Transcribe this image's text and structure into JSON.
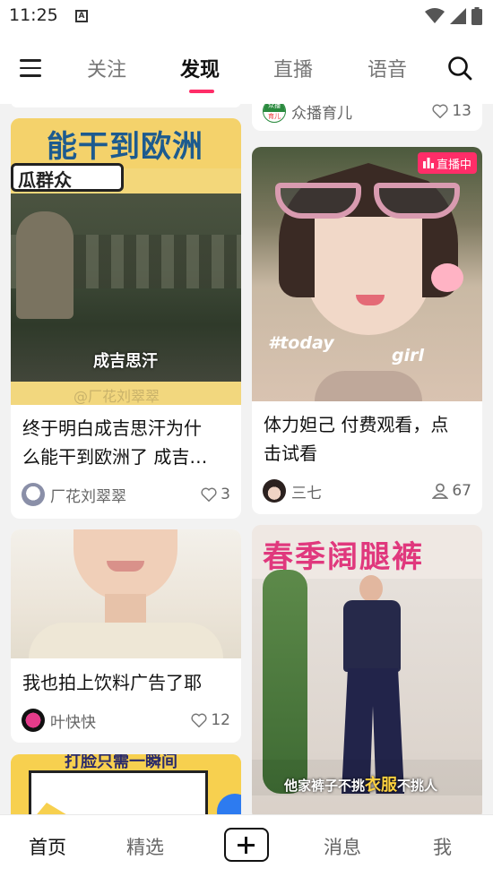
{
  "status_bar": {
    "time": "11:25",
    "app_icon": "A"
  },
  "top_nav": {
    "tabs": [
      {
        "label": "关注",
        "active": false
      },
      {
        "label": "发现",
        "active": true
      },
      {
        "label": "直播",
        "active": false
      },
      {
        "label": "语音",
        "active": false
      }
    ],
    "accent_color": "#ff2d68"
  },
  "feed": {
    "top_right_stub": {
      "author": "众播育儿",
      "likes": "13",
      "avatar_text_1": "众播",
      "avatar_text_2": "育儿"
    },
    "card1": {
      "image_banner": "能干到欧洲",
      "image_tag": "瓜群众",
      "image_caption": "成吉思汗",
      "image_watermark": "@厂花刘翠翠",
      "title_line1": "终于明白成吉思汗为什",
      "title_line2": "么能干到欧洲了 成吉…",
      "author": "厂花刘翠翠",
      "likes": "3"
    },
    "card2": {
      "live_badge": "直播中",
      "image_text_left": "#today",
      "image_text_right": "girl",
      "title_line1": "体力妲己  付费观看，点",
      "title_line2": "击试看",
      "author": "三七",
      "viewers": "67"
    },
    "card3": {
      "title": "我也拍上饮料广告了耶",
      "author": "叶快快",
      "likes": "12"
    },
    "card4": {
      "image_banner": "春季阔腿裤",
      "image_caption_a": "他家裤子不挑",
      "image_caption_b": "衣服",
      "image_caption_c": "不挑人"
    },
    "card5": {
      "image_banner": "打脸只需一瞬间"
    }
  },
  "bottom_nav": {
    "items": [
      {
        "label": "首页",
        "active": true
      },
      {
        "label": "精选",
        "active": false
      },
      {
        "label": "消息",
        "active": false
      },
      {
        "label": "我",
        "active": false
      }
    ]
  }
}
